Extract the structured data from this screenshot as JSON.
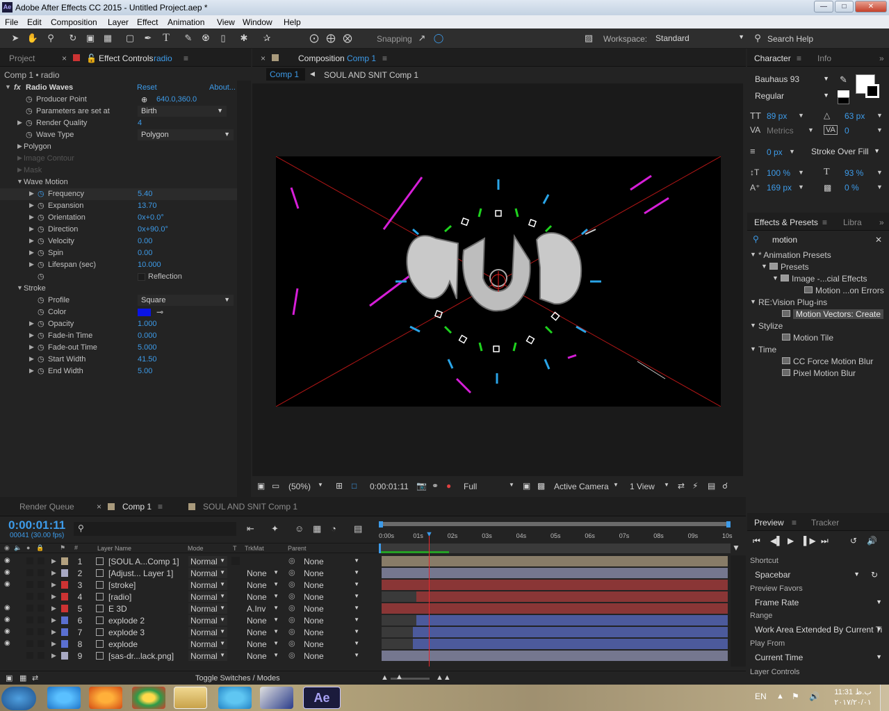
{
  "window": {
    "title": "Adobe After Effects CC 2015 - Untitled Project.aep *",
    "app_badge": "Ae"
  },
  "menu": [
    "File",
    "Edit",
    "Composition",
    "Layer",
    "Effect",
    "Animation",
    "View",
    "Window",
    "Help"
  ],
  "toolbar": {
    "snapping": "Snapping",
    "workspace_label": "Workspace:",
    "workspace": "Standard",
    "search_help": "Search Help"
  },
  "left_panel": {
    "tab_project": "Project",
    "tab_effect_controls": "Effect Controls",
    "tab_effect_layer": "radio",
    "breadcrumb": "Comp 1 • radio",
    "effect_name": "Radio Waves",
    "reset": "Reset",
    "about": "About...",
    "rows": [
      {
        "label": "Producer Point",
        "value": "640.0,360.0"
      },
      {
        "label": "Parameters are set at",
        "dropdown": "Birth"
      },
      {
        "label": "Render Quality",
        "value": "4"
      },
      {
        "label": "Wave Type",
        "dropdown": "Polygon"
      },
      {
        "label": "Polygon"
      },
      {
        "label": "Image Contour"
      },
      {
        "label": "Mask"
      },
      {
        "label": "Wave Motion"
      },
      {
        "label": "Frequency",
        "value": "5.40"
      },
      {
        "label": "Expansion",
        "value": "13.70"
      },
      {
        "label": "Orientation",
        "value": "0x+0.0°"
      },
      {
        "label": "Direction",
        "value": "0x+90.0°"
      },
      {
        "label": "Velocity",
        "value": "0.00"
      },
      {
        "label": "Spin",
        "value": "0.00"
      },
      {
        "label": "Lifespan (sec)",
        "value": "10.000"
      },
      {
        "label": "Reflection"
      },
      {
        "label": "Stroke"
      },
      {
        "label": "Profile",
        "dropdown": "Square"
      },
      {
        "label": "Color"
      },
      {
        "label": "Opacity",
        "value": "1.000"
      },
      {
        "label": "Fade-in Time",
        "value": "0.000"
      },
      {
        "label": "Fade-out Time",
        "value": "5.000"
      },
      {
        "label": "Start Width",
        "value": "41.50"
      },
      {
        "label": "End Width",
        "value": "5.00"
      }
    ]
  },
  "viewer": {
    "tab_label": "Composition",
    "tab_comp": "Comp 1",
    "crumb_active": "Comp 1",
    "crumb_other": "SOUL AND SNIT Comp 1",
    "zoom": "(50%)",
    "timecode": "0:00:01:11",
    "resolution": "Full",
    "camera": "Active Camera",
    "views": "1 View"
  },
  "character": {
    "tab_character": "Character",
    "tab_info": "Info",
    "font": "Bauhaus 93",
    "style": "Regular",
    "size": "89 px",
    "leading": "63 px",
    "kerning": "Metrics",
    "tracking": "0",
    "stroke_width": "0 px",
    "stroke_mode": "Stroke Over Fill",
    "vscale": "100 %",
    "hscale": "93 %",
    "baseline": "169 px",
    "tsume": "0 %"
  },
  "effects_presets": {
    "tab": "Effects & Presets",
    "tab_libraries": "Libra",
    "search": "motion",
    "tree": [
      {
        "label": "* Animation Presets",
        "level": 0,
        "kind": "folder-open"
      },
      {
        "label": "Presets",
        "level": 1,
        "kind": "folder"
      },
      {
        "label": "Image -...cial Effects",
        "level": 2,
        "kind": "folder"
      },
      {
        "label": "Motion ...on Errors",
        "level": 3,
        "kind": "preset"
      },
      {
        "label": "RE:Vision Plug-ins",
        "level": 0,
        "kind": "category"
      },
      {
        "label": "Motion Vectors: Create",
        "level": 1,
        "kind": "effect",
        "selected": true
      },
      {
        "label": "Stylize",
        "level": 0,
        "kind": "category"
      },
      {
        "label": "Motion Tile",
        "level": 1,
        "kind": "effect"
      },
      {
        "label": "Time",
        "level": 0,
        "kind": "category"
      },
      {
        "label": "CC Force Motion Blur",
        "level": 1,
        "kind": "effect"
      },
      {
        "label": "Pixel Motion Blur",
        "level": 1,
        "kind": "effect"
      }
    ]
  },
  "preview": {
    "tab_preview": "Preview",
    "tab_tracker": "Tracker",
    "shortcut_label": "Shortcut",
    "shortcut": "Spacebar",
    "favors_label": "Preview Favors",
    "favors": "Frame Rate",
    "range_label": "Range",
    "range": "Work Area Extended By Current Ti",
    "play_from_label": "Play From",
    "play_from": "Current Time",
    "layer_controls_label": "Layer Controls"
  },
  "timeline": {
    "tab_render": "Render Queue",
    "tab_comp1": "Comp 1",
    "tab_soul": "SOUL AND SNIT Comp 1",
    "timecode": "0:00:01:11",
    "frames": "00041 (30.00 fps)",
    "col_layer_name": "Layer Name",
    "col_mode": "Mode",
    "col_t": "T",
    "col_trkmat": "TrkMat",
    "col_parent": "Parent",
    "ruler": [
      "0:00s",
      "01s",
      "02s",
      "03s",
      "04s",
      "05s",
      "06s",
      "07s",
      "08s",
      "09s",
      "10s"
    ],
    "toggle": "Toggle Switches / Modes",
    "layers": [
      {
        "num": "1",
        "name": "[SOUL A...Comp 1]",
        "mode": "Normal",
        "trkmat": "",
        "parent": "None",
        "label_color": "#b3a180",
        "bar_color": "#887c68",
        "bar_start": 0.0,
        "bar_end": 1.0
      },
      {
        "num": "2",
        "name": "[Adjust... Layer 1]",
        "mode": "Normal",
        "trkmat": "None",
        "parent": "None",
        "label_color": "#a8a9c4",
        "bar_color": "#75778f",
        "bar_start": 0.0,
        "bar_end": 1.0
      },
      {
        "num": "3",
        "name": "[stroke]",
        "mode": "Normal",
        "trkmat": "None",
        "parent": "None",
        "label_color": "#cc3333",
        "bar_color": "#8a3636",
        "bar_start": 0.0,
        "bar_end": 1.0
      },
      {
        "num": "4",
        "name": "[radio]",
        "mode": "Normal",
        "trkmat": "None",
        "parent": "None",
        "label_color": "#cc3333",
        "bar_color": "#8a3636",
        "bar_start": 0.1,
        "bar_end": 1.0
      },
      {
        "num": "5",
        "name": "E 3D",
        "mode": "Normal",
        "trkmat": "A.Inv",
        "parent": "None",
        "label_color": "#cc3333",
        "bar_color": "#8a3636",
        "bar_start": 0.0,
        "bar_end": 1.0
      },
      {
        "num": "6",
        "name": "explode 2",
        "mode": "Normal",
        "trkmat": "None",
        "parent": "None",
        "label_color": "#5a6fd1",
        "bar_color": "#4c5a9c",
        "bar_start": 0.1,
        "bar_end": 1.0
      },
      {
        "num": "7",
        "name": "explode 3",
        "mode": "Normal",
        "trkmat": "None",
        "parent": "None",
        "label_color": "#5a6fd1",
        "bar_color": "#4c5a9c",
        "bar_start": 0.09,
        "bar_end": 1.0
      },
      {
        "num": "8",
        "name": "explode",
        "mode": "Normal",
        "trkmat": "None",
        "parent": "None",
        "label_color": "#5a6fd1",
        "bar_color": "#4c5a9c",
        "bar_start": 0.09,
        "bar_end": 1.0
      },
      {
        "num": "9",
        "name": "[sas-dr...lack.png]",
        "mode": "Normal",
        "trkmat": "None",
        "parent": "None",
        "label_color": "#a8a9c4",
        "bar_color": "#75778f",
        "bar_start": 0.0,
        "bar_end": 1.0
      }
    ]
  },
  "taskbar": {
    "lang": "EN",
    "time": "11:31 ب.ظ",
    "date": "٢٠١٧/٢٠/٠١"
  }
}
